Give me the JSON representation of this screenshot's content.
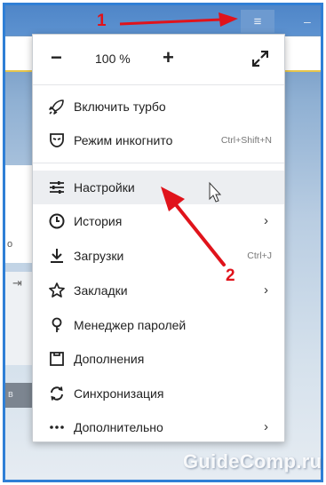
{
  "menu": {
    "zoom": {
      "minus": "−",
      "value": "100 %",
      "plus": "+"
    },
    "items": [
      {
        "label": "Включить турбо",
        "icon": "rocket-icon"
      },
      {
        "label": "Режим инкогнито",
        "icon": "incognito-mask-icon",
        "shortcut": "Ctrl+Shift+N"
      },
      {
        "label": "Настройки",
        "icon": "settings-sliders-icon"
      },
      {
        "label": "История",
        "icon": "history-clock-icon",
        "submenu": "›"
      },
      {
        "label": "Загрузки",
        "icon": "download-icon",
        "shortcut": "Ctrl+J"
      },
      {
        "label": "Закладки",
        "icon": "bookmark-star-icon",
        "submenu": "›"
      },
      {
        "label": "Менеджер паролей",
        "icon": "key-icon"
      },
      {
        "label": "Дополнения",
        "icon": "extensions-icon"
      },
      {
        "label": "Синхронизация",
        "icon": "sync-icon"
      },
      {
        "label": "Дополнительно",
        "icon": "more-dots-icon",
        "submenu": "›"
      }
    ]
  },
  "titlebar": {
    "menu_icon": "≡",
    "minimize": "–"
  },
  "background": {
    "left_text_1": "о",
    "left_text_2": "в"
  },
  "annotations": {
    "step_1": "1",
    "step_2": "2",
    "watermark": "GuideComp.ru",
    "arrow_color": "#e0131b"
  }
}
